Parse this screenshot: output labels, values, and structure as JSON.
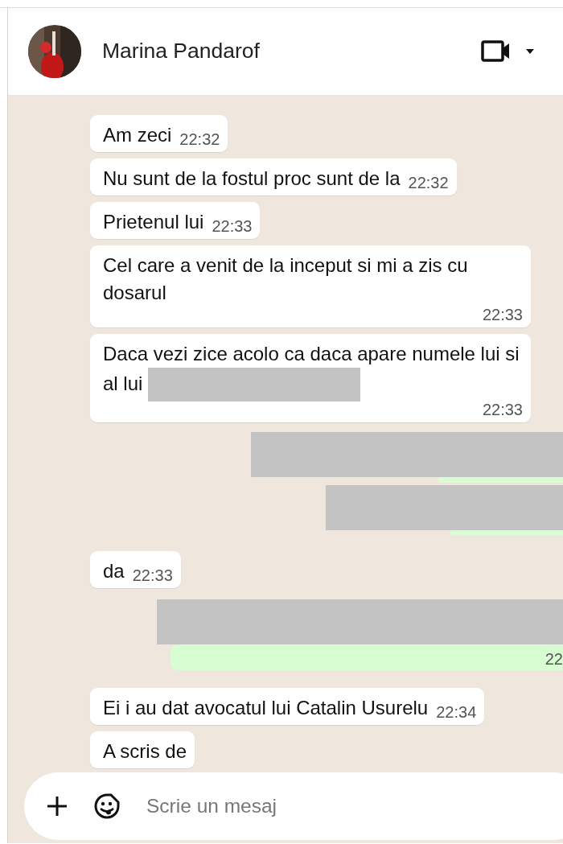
{
  "header": {
    "contact_name": "Marina Pandarof"
  },
  "messages": [
    {
      "kind": "in",
      "text": "Am zeci",
      "time": "22:32"
    },
    {
      "kind": "in",
      "text": "Nu sunt de la fostul proc sunt de la",
      "time": "22:32"
    },
    {
      "kind": "in",
      "text": "Prietenul lui",
      "time": "22:33"
    },
    {
      "kind": "in",
      "text": "Cel care a venit de la inceput si mi a zis cu dosarul",
      "time": "22:33"
    },
    {
      "kind": "in",
      "text": "Daca vezi zice acolo ca daca apare numele lui si al lui",
      "time": "22:33",
      "redacted": true
    },
    {
      "kind": "out",
      "redacted": true
    },
    {
      "kind": "out",
      "redacted": true
    },
    {
      "kind": "in",
      "text": "da",
      "time": "22:33"
    },
    {
      "kind": "out",
      "redacted": true,
      "time": "22"
    },
    {
      "kind": "in",
      "text": "Ei i au dat avocatul lui Catalin Usurelu",
      "time": "22:34"
    },
    {
      "kind": "in",
      "text": "A scris de"
    }
  ],
  "composer": {
    "placeholder": "Scrie un mesaj"
  }
}
